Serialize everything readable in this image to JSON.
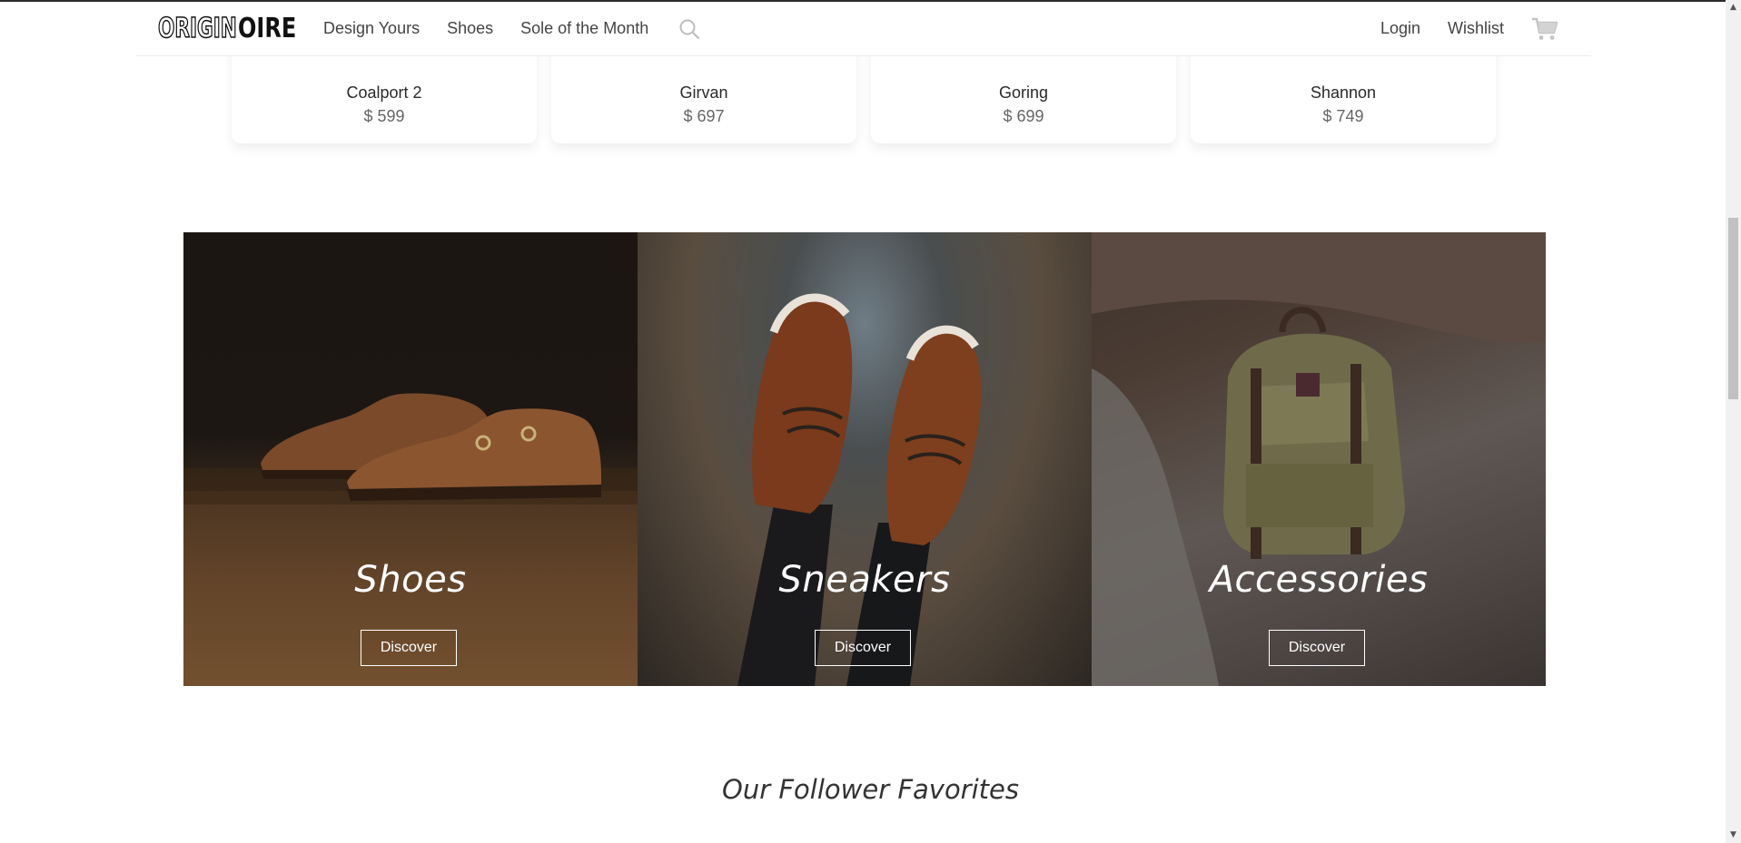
{
  "header": {
    "logo_left": "ORIGIN",
    "logo_right": "OIRE",
    "nav": [
      "Design Yours",
      "Shoes",
      "Sole of the Month"
    ],
    "login": "Login",
    "wishlist": "Wishlist"
  },
  "products": [
    {
      "name": "Coalport 2",
      "price": "$ 599"
    },
    {
      "name": "Girvan",
      "price": "$ 697"
    },
    {
      "name": "Goring",
      "price": "$ 699"
    },
    {
      "name": "Shannon",
      "price": "$ 749"
    }
  ],
  "categories": [
    {
      "title": "Shoes",
      "button": "Discover"
    },
    {
      "title": "Sneakers",
      "button": "Discover"
    },
    {
      "title": "Accessories",
      "button": "Discover"
    }
  ],
  "section_title": "Our Follower Favorites",
  "icons": {
    "search": "search-icon",
    "cart": "cart-icon"
  },
  "colors": {
    "text": "#2a2a2a",
    "muted": "#666666",
    "accent_white": "#ffffff"
  }
}
